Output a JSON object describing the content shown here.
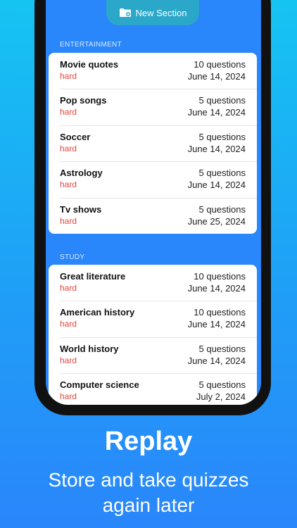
{
  "toolbar": {
    "new_section_label": "New Section",
    "new_section_icon": "folder-badge-plus-icon"
  },
  "sections": [
    {
      "header": "ENTERTAINMENT",
      "items": [
        {
          "name": "Movie quotes",
          "difficulty": "hard",
          "questions": "10 questions",
          "date": "June 14, 2024"
        },
        {
          "name": "Pop songs",
          "difficulty": "hard",
          "questions": "5 questions",
          "date": "June 14, 2024"
        },
        {
          "name": "Soccer",
          "difficulty": "hard",
          "questions": "5 questions",
          "date": "June 14, 2024"
        },
        {
          "name": "Astrology",
          "difficulty": "hard",
          "questions": "5 questions",
          "date": "June 14, 2024"
        },
        {
          "name": "Tv shows",
          "difficulty": "hard",
          "questions": "5 questions",
          "date": "June 25, 2024"
        }
      ]
    },
    {
      "header": "STUDY",
      "items": [
        {
          "name": "Great literature",
          "difficulty": "hard",
          "questions": "10 questions",
          "date": "June 14, 2024"
        },
        {
          "name": "American history",
          "difficulty": "hard",
          "questions": "10 questions",
          "date": "June 14, 2024"
        },
        {
          "name": "World history",
          "difficulty": "hard",
          "questions": "5 questions",
          "date": "June 14, 2024"
        },
        {
          "name": "Computer science",
          "difficulty": "hard",
          "questions": "5 questions",
          "date": "July 2, 2024"
        }
      ]
    }
  ],
  "promo": {
    "title": "Replay",
    "subtitle_line1": "Store and take quizzes",
    "subtitle_line2": "again later"
  },
  "colors": {
    "accent": "#2a86fb",
    "difficulty_hard": "#e8453c",
    "button": "#2ba8c9"
  }
}
